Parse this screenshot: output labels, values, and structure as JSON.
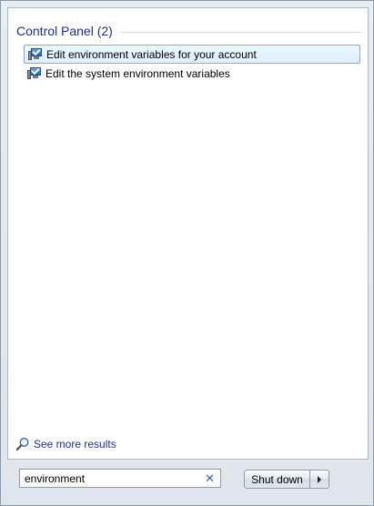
{
  "results": {
    "group_title": "Control Panel (2)",
    "items": [
      {
        "label": "Edit environment variables for your account",
        "icon": "control-panel-icon",
        "selected": true
      },
      {
        "label": "Edit the system environment variables",
        "icon": "control-panel-icon",
        "selected": false
      }
    ]
  },
  "see_more": {
    "label": "See more results",
    "icon": "magnifier-icon"
  },
  "search": {
    "value": "environment",
    "clear_icon": "close-icon"
  },
  "shutdown": {
    "label": "Shut down",
    "arrow_icon": "arrow-right-icon"
  },
  "colors": {
    "link": "#1e3287",
    "selection_border": "#84acdd",
    "accent_blue": "#2a6fc9"
  }
}
